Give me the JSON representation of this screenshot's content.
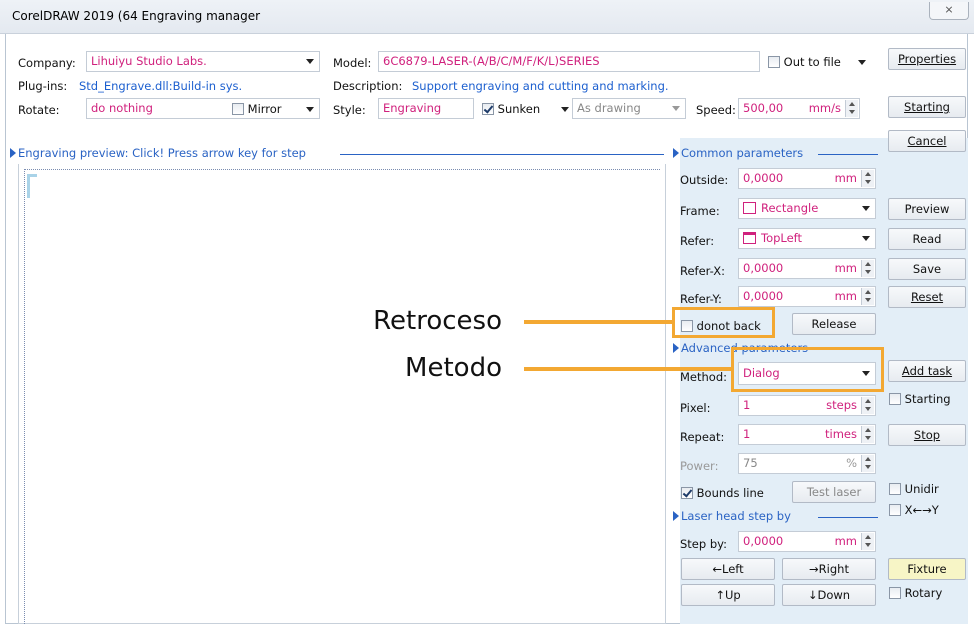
{
  "window": {
    "title": "CorelDRAW 2019 (64 Engraving manager",
    "close_glyph": "⨯"
  },
  "top": {
    "company_label": "Company:",
    "company_value": "Lihuiyu Studio Labs.",
    "model_label": "Model:",
    "model_value": "6C6879-LASER-(A/B/C/M/F/K/L)SERIES",
    "out_to_file_label": "Out to file",
    "properties_label": "Properties",
    "plugins_label": "Plug-ins:",
    "plugins_value": "Std_Engrave.dll:Build-in sys.",
    "description_label": "Description:",
    "description_value": "Support engraving and cutting and marking.",
    "rotate_label": "Rotate:",
    "rotate_value": "do nothing",
    "mirror_label": "Mirror",
    "style_label": "Style:",
    "style_value": "Engraving",
    "sunken_label": "Sunken",
    "sunken_checked": true,
    "as_drawing_value": "As drawing",
    "speed_label": "Speed:",
    "speed_value": "500,00",
    "speed_unit": "mm/s",
    "starting_label": "Starting",
    "cancel_label": "Cancel"
  },
  "preview": {
    "header": "Engraving preview: Click! Press arrow key for step"
  },
  "common": {
    "header": "Common parameters",
    "outside_label": "Outside:",
    "outside_value": "0,0000",
    "outside_unit": "mm",
    "frame_label": "Frame:",
    "frame_value": "Rectangle",
    "refer_label": "Refer:",
    "refer_value": "TopLeft",
    "referx_label": "Refer-X:",
    "referx_value": "0,0000",
    "referx_unit": "mm",
    "refery_label": "Refer-Y:",
    "refery_value": "0,0000",
    "refery_unit": "mm",
    "donot_back_label": "donot back",
    "release_label": "Release",
    "preview_btn": "Preview",
    "read_btn": "Read",
    "save_btn": "Save",
    "reset_btn": "Reset"
  },
  "advanced": {
    "header": "Advanced parameters",
    "method_label": "Method:",
    "method_value": "Dialog",
    "add_task_label": "Add task",
    "pixel_label": "Pixel:",
    "pixel_value": "1",
    "pixel_unit": "steps",
    "repeat_label": "Repeat:",
    "repeat_value": "1",
    "repeat_unit": "times",
    "power_label": "Power:",
    "power_value": "75",
    "power_unit": "%",
    "starting_chk_label": "Starting",
    "stop_label": "Stop",
    "bounds_line_label": "Bounds line",
    "bounds_line_checked": true,
    "test_laser_label": "Test laser",
    "unidir_label": "Unidir",
    "xy_label": "X←→Y"
  },
  "laserhead": {
    "header": "Laser head step by",
    "stepby_label": "Step by:",
    "stepby_value": "0,0000",
    "stepby_unit": "mm",
    "left_label": "←Left",
    "right_label": "→Right",
    "up_label": "↑Up",
    "down_label": "↓Down",
    "fixture_label": "Fixture",
    "rotary_label": "Rotary"
  },
  "annotations": {
    "retroceso": "Retroceso",
    "metodo": "Metodo",
    "highlight_color": "#f3a832"
  }
}
